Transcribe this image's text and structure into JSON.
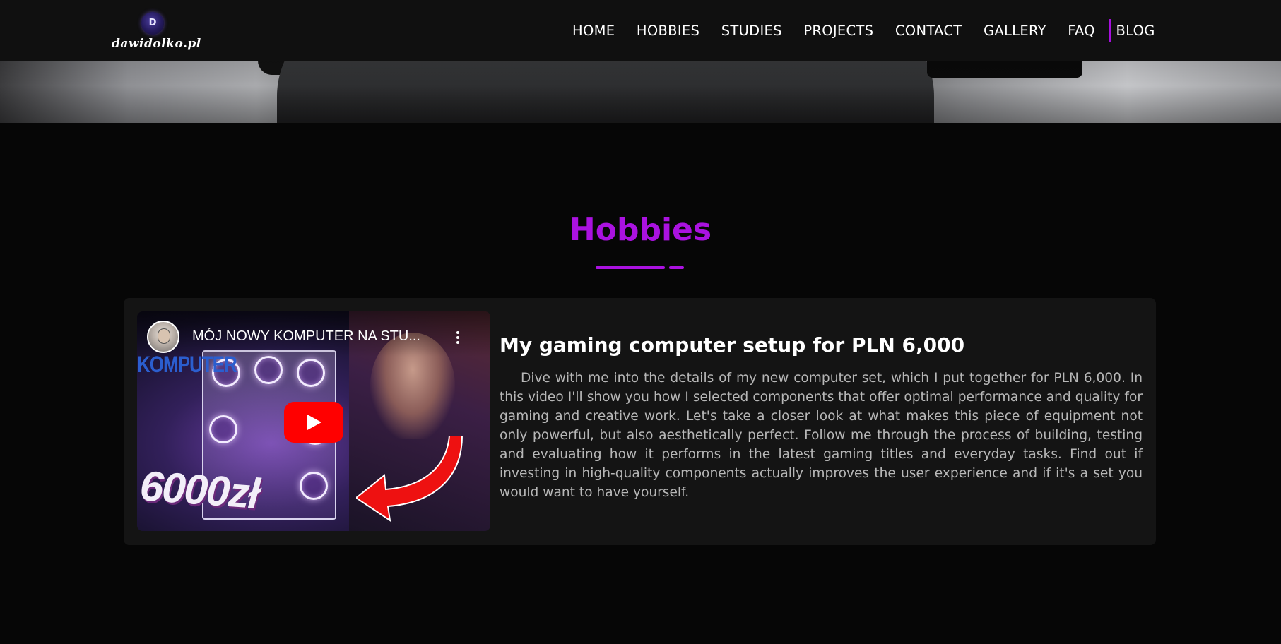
{
  "logo": {
    "letter": "D",
    "text": "dawidolko.pl",
    "icon": "logo-badge"
  },
  "nav": {
    "items": [
      "HOME",
      "HOBBIES",
      "STUDIES",
      "PROJECTS",
      "CONTACT",
      "GALLERY",
      "FAQ",
      "BLOG"
    ],
    "accent_color": "#a60fdd"
  },
  "section": {
    "title": "Hobbies",
    "accent_color": "#aa12e0"
  },
  "video": {
    "title": "MÓJ NOWY KOMPUTER NA STU...",
    "channel_overlay": "KOMPUTER",
    "price_overlay": "6000zł",
    "icons": [
      "channel-avatar",
      "more-vert-icon",
      "youtube-play-icon",
      "red-arrow"
    ]
  },
  "post": {
    "title": "My gaming computer setup for PLN 6,000",
    "body": "Dive with me into the details of my new computer set, which I put together for PLN 6,000. In this video I'll show you how I selected components that offer optimal performance and quality for gaming and creative work. Let's take a closer look at what makes this piece of equipment not only powerful, but also aesthetically perfect. Follow me through the process of building, testing and evaluating how it performs in the latest gaming titles and everyday tasks. Find out if investing in high-quality components actually improves the user experience and if it's a set you would want to have yourself."
  }
}
